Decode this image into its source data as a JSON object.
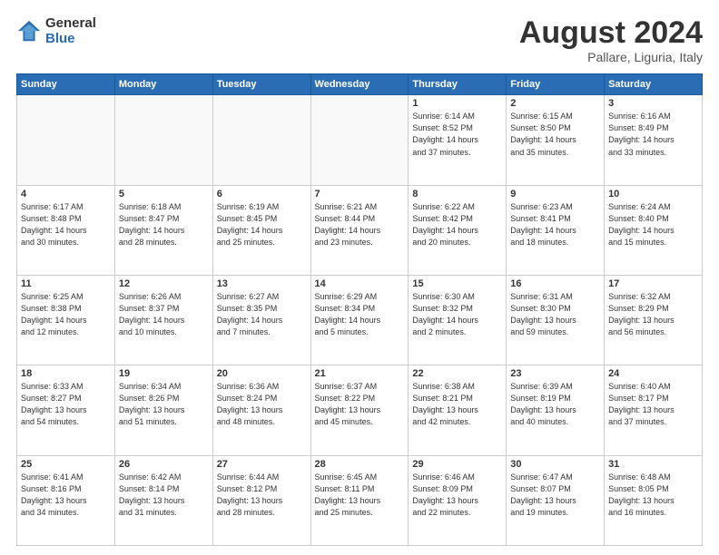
{
  "header": {
    "logo_general": "General",
    "logo_blue": "Blue",
    "month_title": "August 2024",
    "subtitle": "Pallare, Liguria, Italy"
  },
  "weekdays": [
    "Sunday",
    "Monday",
    "Tuesday",
    "Wednesday",
    "Thursday",
    "Friday",
    "Saturday"
  ],
  "rows": [
    [
      {
        "day": "",
        "info": "",
        "empty": true
      },
      {
        "day": "",
        "info": "",
        "empty": true
      },
      {
        "day": "",
        "info": "",
        "empty": true
      },
      {
        "day": "",
        "info": "",
        "empty": true
      },
      {
        "day": "1",
        "info": "Sunrise: 6:14 AM\nSunset: 8:52 PM\nDaylight: 14 hours\nand 37 minutes."
      },
      {
        "day": "2",
        "info": "Sunrise: 6:15 AM\nSunset: 8:50 PM\nDaylight: 14 hours\nand 35 minutes."
      },
      {
        "day": "3",
        "info": "Sunrise: 6:16 AM\nSunset: 8:49 PM\nDaylight: 14 hours\nand 33 minutes."
      }
    ],
    [
      {
        "day": "4",
        "info": "Sunrise: 6:17 AM\nSunset: 8:48 PM\nDaylight: 14 hours\nand 30 minutes."
      },
      {
        "day": "5",
        "info": "Sunrise: 6:18 AM\nSunset: 8:47 PM\nDaylight: 14 hours\nand 28 minutes."
      },
      {
        "day": "6",
        "info": "Sunrise: 6:19 AM\nSunset: 8:45 PM\nDaylight: 14 hours\nand 25 minutes."
      },
      {
        "day": "7",
        "info": "Sunrise: 6:21 AM\nSunset: 8:44 PM\nDaylight: 14 hours\nand 23 minutes."
      },
      {
        "day": "8",
        "info": "Sunrise: 6:22 AM\nSunset: 8:42 PM\nDaylight: 14 hours\nand 20 minutes."
      },
      {
        "day": "9",
        "info": "Sunrise: 6:23 AM\nSunset: 8:41 PM\nDaylight: 14 hours\nand 18 minutes."
      },
      {
        "day": "10",
        "info": "Sunrise: 6:24 AM\nSunset: 8:40 PM\nDaylight: 14 hours\nand 15 minutes."
      }
    ],
    [
      {
        "day": "11",
        "info": "Sunrise: 6:25 AM\nSunset: 8:38 PM\nDaylight: 14 hours\nand 12 minutes."
      },
      {
        "day": "12",
        "info": "Sunrise: 6:26 AM\nSunset: 8:37 PM\nDaylight: 14 hours\nand 10 minutes."
      },
      {
        "day": "13",
        "info": "Sunrise: 6:27 AM\nSunset: 8:35 PM\nDaylight: 14 hours\nand 7 minutes."
      },
      {
        "day": "14",
        "info": "Sunrise: 6:29 AM\nSunset: 8:34 PM\nDaylight: 14 hours\nand 5 minutes."
      },
      {
        "day": "15",
        "info": "Sunrise: 6:30 AM\nSunset: 8:32 PM\nDaylight: 14 hours\nand 2 minutes."
      },
      {
        "day": "16",
        "info": "Sunrise: 6:31 AM\nSunset: 8:30 PM\nDaylight: 13 hours\nand 59 minutes."
      },
      {
        "day": "17",
        "info": "Sunrise: 6:32 AM\nSunset: 8:29 PM\nDaylight: 13 hours\nand 56 minutes."
      }
    ],
    [
      {
        "day": "18",
        "info": "Sunrise: 6:33 AM\nSunset: 8:27 PM\nDaylight: 13 hours\nand 54 minutes."
      },
      {
        "day": "19",
        "info": "Sunrise: 6:34 AM\nSunset: 8:26 PM\nDaylight: 13 hours\nand 51 minutes."
      },
      {
        "day": "20",
        "info": "Sunrise: 6:36 AM\nSunset: 8:24 PM\nDaylight: 13 hours\nand 48 minutes."
      },
      {
        "day": "21",
        "info": "Sunrise: 6:37 AM\nSunset: 8:22 PM\nDaylight: 13 hours\nand 45 minutes."
      },
      {
        "day": "22",
        "info": "Sunrise: 6:38 AM\nSunset: 8:21 PM\nDaylight: 13 hours\nand 42 minutes."
      },
      {
        "day": "23",
        "info": "Sunrise: 6:39 AM\nSunset: 8:19 PM\nDaylight: 13 hours\nand 40 minutes."
      },
      {
        "day": "24",
        "info": "Sunrise: 6:40 AM\nSunset: 8:17 PM\nDaylight: 13 hours\nand 37 minutes."
      }
    ],
    [
      {
        "day": "25",
        "info": "Sunrise: 6:41 AM\nSunset: 8:16 PM\nDaylight: 13 hours\nand 34 minutes."
      },
      {
        "day": "26",
        "info": "Sunrise: 6:42 AM\nSunset: 8:14 PM\nDaylight: 13 hours\nand 31 minutes."
      },
      {
        "day": "27",
        "info": "Sunrise: 6:44 AM\nSunset: 8:12 PM\nDaylight: 13 hours\nand 28 minutes."
      },
      {
        "day": "28",
        "info": "Sunrise: 6:45 AM\nSunset: 8:11 PM\nDaylight: 13 hours\nand 25 minutes."
      },
      {
        "day": "29",
        "info": "Sunrise: 6:46 AM\nSunset: 8:09 PM\nDaylight: 13 hours\nand 22 minutes."
      },
      {
        "day": "30",
        "info": "Sunrise: 6:47 AM\nSunset: 8:07 PM\nDaylight: 13 hours\nand 19 minutes."
      },
      {
        "day": "31",
        "info": "Sunrise: 6:48 AM\nSunset: 8:05 PM\nDaylight: 13 hours\nand 16 minutes."
      }
    ]
  ]
}
